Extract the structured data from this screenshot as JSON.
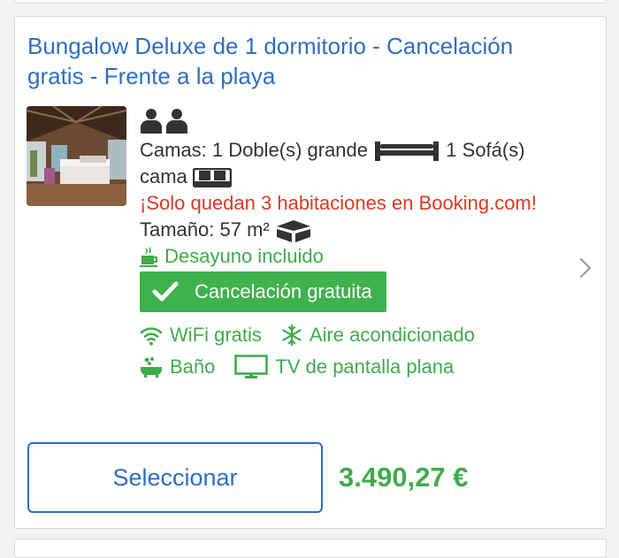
{
  "room": {
    "title": "Bungalow Deluxe de 1 dormitorio - Cancelación gratis - Frente a la playa",
    "beds_text": "Camas: 1 Doble(s) grande",
    "beds_sofa_count": "1",
    "beds_sofa_text": "Sofá(s) cama",
    "availability": "¡Solo quedan 3 habitaciones en Booking.com!",
    "size": "Tamaño: 57 m²",
    "breakfast": "Desayuno incluido",
    "free_cancellation": "Cancelación gratuita",
    "facilities": [
      {
        "label": "WiFi gratis",
        "icon": "wifi-icon"
      },
      {
        "label": "Aire acondicionado",
        "icon": "snowflake-icon"
      },
      {
        "label": "Baño",
        "icon": "bathtub-icon"
      },
      {
        "label": "TV de pantalla plana",
        "icon": "tv-icon"
      }
    ]
  },
  "actions": {
    "select_label": "Seleccionar",
    "price": "3.490,27 €"
  },
  "colors": {
    "link_blue": "#2e6fc1",
    "green": "#40ab4c",
    "badge_green": "#3fb24c",
    "urgency_red": "#d93a24"
  }
}
